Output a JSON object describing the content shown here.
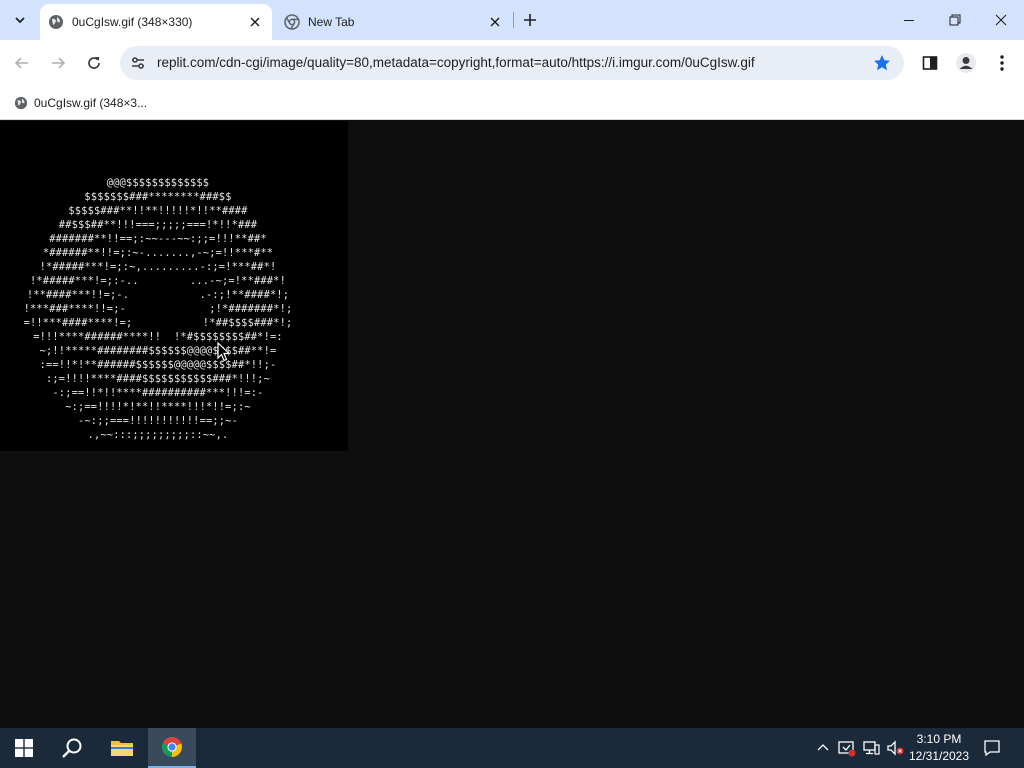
{
  "browser": {
    "tabs": [
      {
        "title": "0uCgIsw.gif (348×330)",
        "active": true
      },
      {
        "title": "New Tab",
        "active": false
      }
    ],
    "address_bar": {
      "url": "replit.com/cdn-cgi/image/quality=80,metadata=copyright,format=auto/https://i.imgur.com/0uCgIsw.gif"
    },
    "bookmarks": [
      {
        "label": "0uCgIsw.gif (348×3..."
      }
    ]
  },
  "content": {
    "ascii_art": [
      "@@@$$$$$$$$$$$$$",
      "$$$$$$$###********###$$",
      "$$$$$###**!!**!!!!!*!!**####",
      "##$$$##**!!!===;;;;;===!*!!*###",
      "#######**!!==;:~~---~~:;;=!!!**##*",
      "*######**!!=;:~-.......,-~;=!!***#**",
      "!*#####***!=;:~,.........-:;=!***##*!",
      "!*#####***!=;:-..        ...-~;=!**###*!",
      "!**####***!!=;-.           .-:;!**####*!;",
      "!***###****!!=;-             ;!*#######*!;",
      "=!!***####****!=;           !*##$$$$###*!;",
      "=!!!****######****!!  !*#$$$$$$$$##*!=:",
      "~;!!*****########$$$$$$@@@@$$$$##**!=",
      ":==!!*!**######$$$$$$@@@@@$$$$##*!!;-",
      ":;=!!!!****####$$$$$$$$$$$###*!!!;~",
      "-:;==!!*!!****##########***!!!=:-",
      "~:;==!!!!*!**!!****!!!*!!=;:~",
      "-~:;;===!!!!!!!!!!!==;;~-",
      ".,~~:::;;;;;;;;;::~~,."
    ]
  },
  "taskbar": {
    "clock_time": "3:10 PM",
    "clock_date": "12/31/2023"
  },
  "colors": {
    "tab_strip": "#d3e3fd",
    "omnibox": "#e9eef6",
    "accent_star": "#1a73e8",
    "page_background": "#0e0e0e",
    "taskbar": "#1b2a3a"
  }
}
